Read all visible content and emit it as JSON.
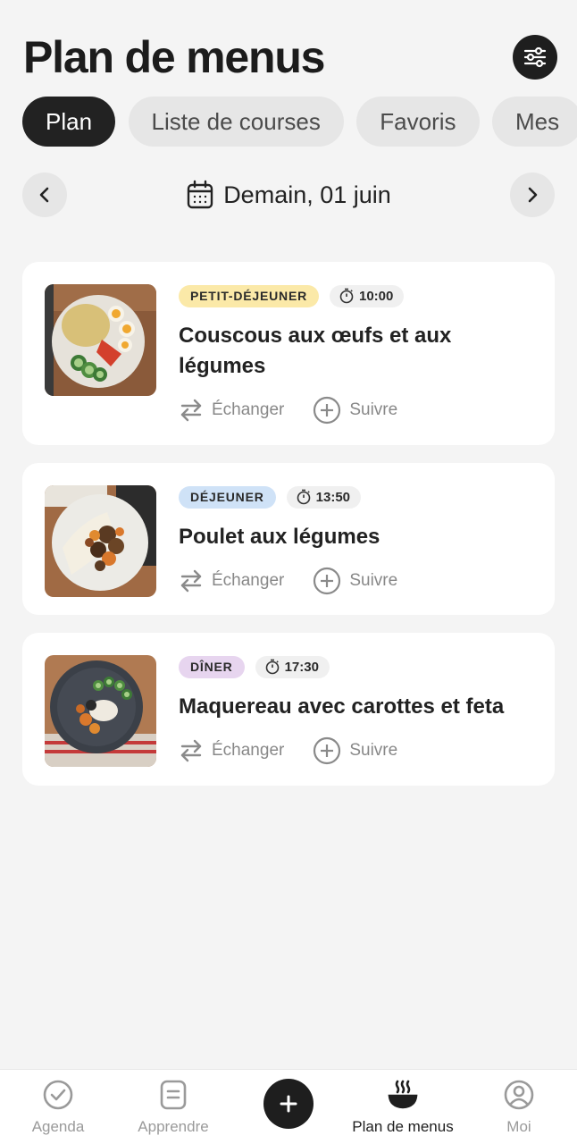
{
  "header": {
    "title": "Plan de menus",
    "filter_icon": "sliders-icon"
  },
  "tabs": [
    {
      "label": "Plan",
      "active": true
    },
    {
      "label": "Liste de courses",
      "active": false
    },
    {
      "label": "Favoris",
      "active": false
    },
    {
      "label": "Mes",
      "active": false
    }
  ],
  "date_nav": {
    "label": "Demain, 01 juin",
    "icon": "calendar-icon"
  },
  "meals": [
    {
      "type": "PETIT-DÉJEUNER",
      "type_color": "#fbe9a8",
      "time": "10:00",
      "title": "Couscous aux œufs et aux légumes",
      "swap_label": "Échanger",
      "track_label": "Suivre"
    },
    {
      "type": "DÉJEUNER",
      "type_color": "#cfe2f7",
      "time": "13:50",
      "title": "Poulet aux légumes",
      "swap_label": "Échanger",
      "track_label": "Suivre"
    },
    {
      "type": "DÎNER",
      "type_color": "#e7d5ef",
      "time": "17:30",
      "title": "Maquereau avec carottes et feta",
      "swap_label": "Échanger",
      "track_label": "Suivre"
    }
  ],
  "bottom_nav": {
    "items": [
      {
        "label": "Agenda",
        "icon": "check-circle-icon",
        "active": false
      },
      {
        "label": "Apprendre",
        "icon": "book-icon",
        "active": false
      },
      {
        "label": "Plan de menus",
        "icon": "bowl-icon",
        "active": true
      },
      {
        "label": "Moi",
        "icon": "profile-icon",
        "active": false
      }
    ],
    "add_icon": "plus-icon"
  }
}
